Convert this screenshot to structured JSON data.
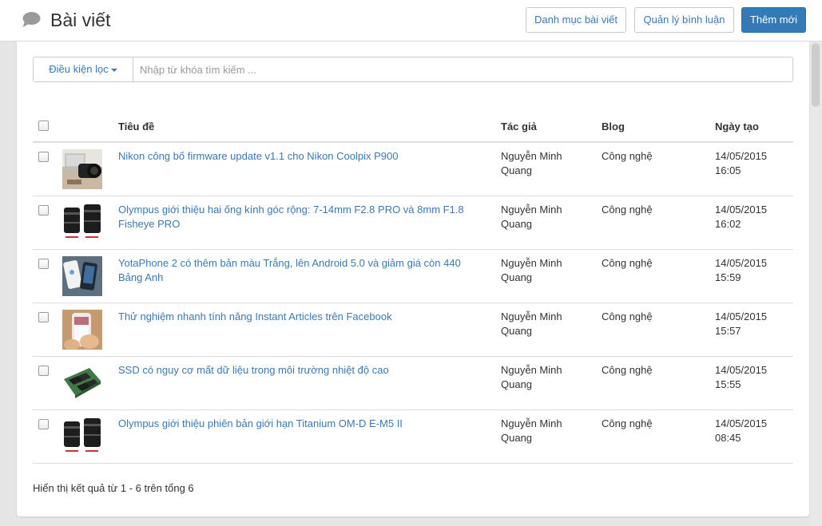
{
  "header": {
    "title": "Bài viết",
    "buttons": {
      "categories": "Danh mục bài viết",
      "comments": "Quản lý bình luận",
      "add_new": "Thêm mới"
    }
  },
  "filter": {
    "button_label": "Điều kiện lọc",
    "search_placeholder": "Nhập từ khóa tìm kiếm ..."
  },
  "table": {
    "columns": {
      "title": "Tiêu đề",
      "author": "Tác giả",
      "blog": "Blog",
      "created": "Ngày tạo"
    },
    "rows": [
      {
        "thumbnail": "camera-laptop-image",
        "title": "Nikon công bố firmware update v1.1 cho Nikon Coolpix P900",
        "author_first": "Nguyễn Minh",
        "author_last": "Quang",
        "blog": "Công nghệ",
        "date": "14/05/2015",
        "time": "16:05"
      },
      {
        "thumbnail": "camera-lenses-image",
        "title": "Olympus giới thiệu hai ống kính góc rộng: 7-14mm F2.8 PRO và 8mm F1.8 Fisheye PRO",
        "author_first": "Nguyễn Minh",
        "author_last": "Quang",
        "blog": "Công nghệ",
        "date": "14/05/2015",
        "time": "16:02"
      },
      {
        "thumbnail": "smartphones-image",
        "title": "YotaPhone 2 có thêm bản màu Trắng, lên Android 5.0 và giảm giá còn 440 Bảng Anh",
        "author_first": "Nguyễn Minh",
        "author_last": "Quang",
        "blog": "Công nghệ",
        "date": "14/05/2015",
        "time": "15:59"
      },
      {
        "thumbnail": "phone-in-hand-image",
        "title": "Thử nghiệm nhanh tính năng Instant Articles trên Facebook",
        "author_first": "Nguyễn Minh",
        "author_last": "Quang",
        "blog": "Công nghệ",
        "date": "14/05/2015",
        "time": "15:57"
      },
      {
        "thumbnail": "ssd-board-image",
        "title": "SSD có nguy cơ mất dữ liệu trong môi trường nhiệt độ cao",
        "author_first": "Nguyễn Minh",
        "author_last": "Quang",
        "blog": "Công nghệ",
        "date": "14/05/2015",
        "time": "15:55"
      },
      {
        "thumbnail": "camera-lenses-image",
        "title": "Olympus giới thiệu phiên bản giới hạn Titanium OM-D E-M5 II",
        "author_first": "Nguyễn Minh",
        "author_last": "Quang",
        "blog": "Công nghệ",
        "date": "14/05/2015",
        "time": "08:45"
      }
    ]
  },
  "summary": "Hiển thị kết quả từ 1 - 6 trên tổng 6",
  "colors": {
    "accent": "#337ab7",
    "link": "#3a79b5",
    "background": "#e5e5e5"
  }
}
